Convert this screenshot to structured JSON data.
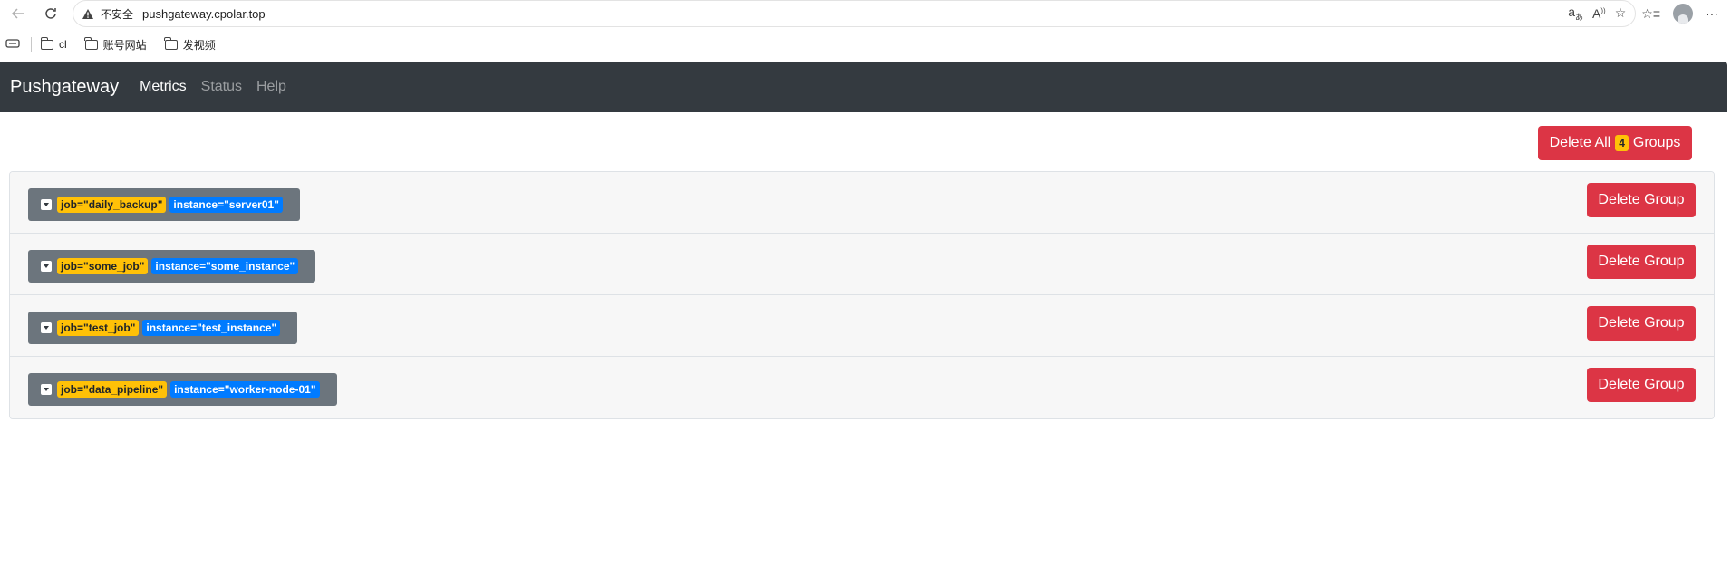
{
  "browser": {
    "insecure_label": "不安全",
    "url": "pushgateway.cpolar.top",
    "bookmarks": [
      {
        "label": "cl"
      },
      {
        "label": "账号网站"
      },
      {
        "label": "发视频"
      }
    ]
  },
  "navbar": {
    "brand": "Pushgateway",
    "links": [
      {
        "label": "Metrics",
        "active": true
      },
      {
        "label": "Status",
        "active": false
      },
      {
        "label": "Help",
        "active": false
      }
    ]
  },
  "delete_all": {
    "prefix": "Delete All",
    "count": "4",
    "suffix": "Groups"
  },
  "groups": [
    {
      "job": "job=\"daily_backup\"",
      "instance": "instance=\"server01\"",
      "button": "Delete Group"
    },
    {
      "job": "job=\"some_job\"",
      "instance": "instance=\"some_instance\"",
      "button": "Delete Group"
    },
    {
      "job": "job=\"test_job\"",
      "instance": "instance=\"test_instance\"",
      "button": "Delete Group"
    },
    {
      "job": "job=\"data_pipeline\"",
      "instance": "instance=\"worker-node-01\"",
      "button": "Delete Group"
    }
  ],
  "colors": {
    "navbar": "#343a40",
    "danger": "#dc3545",
    "warning": "#ffc107",
    "primary": "#007bff",
    "secondary": "#6c757d"
  }
}
